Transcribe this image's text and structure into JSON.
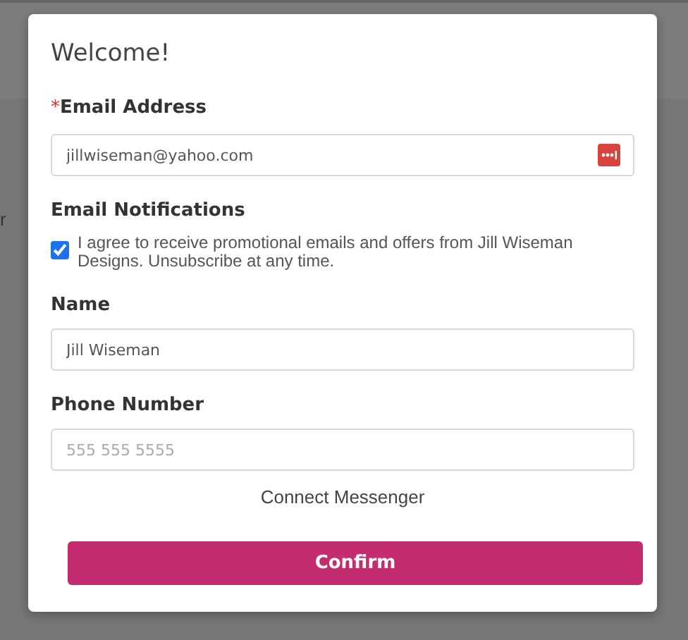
{
  "background": {
    "text": "r"
  },
  "dialog": {
    "title": "Welcome!",
    "email": {
      "label": "Email Address",
      "required_mark": "*",
      "value": "jillwiseman@yahoo.com"
    },
    "notifications": {
      "label": "Email Notifications",
      "checked": true,
      "text": "I agree to receive promotional emails and offers from Jill Wiseman Designs. Unsubscribe at any time."
    },
    "name": {
      "label": "Name",
      "value": "Jill Wiseman"
    },
    "phone": {
      "label": "Phone Number",
      "placeholder": "555 555 5555"
    },
    "link": "Connect Messenger",
    "button": "Confirm"
  }
}
